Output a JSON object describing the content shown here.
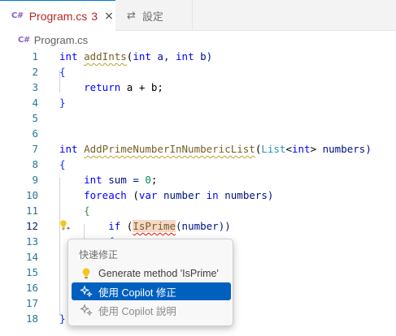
{
  "tabs": [
    {
      "icon": "C#",
      "title": "Program.cs",
      "badge": "3",
      "close": "×"
    },
    {
      "icon": "⇄",
      "title": "設定"
    }
  ],
  "breadcrumb": {
    "icon": "C#",
    "file": "Program.cs"
  },
  "line_numbers": [
    "1",
    "2",
    "3",
    "4",
    "5",
    "6",
    "7",
    "8",
    "9",
    "10",
    "11",
    "12",
    "13",
    "14",
    "15",
    "16",
    "17",
    "18"
  ],
  "code": {
    "l1": {
      "int": "int",
      "fn": "addInts",
      "p1": "(",
      "int2": "int",
      "a": " a, ",
      "int3": "int",
      "b": " b)"
    },
    "l2": "{",
    "l3": {
      "ret": "return",
      "expr": " a + b;"
    },
    "l4": "}",
    "l7": {
      "int": "int",
      "fn": "AddPrimeNumberInNumbericList",
      "p1": "(",
      "list": "List",
      "lt": "<",
      "int2": "int",
      "gt": ">",
      "numbers": " numbers)"
    },
    "l8": "{",
    "l9": {
      "int": "int",
      "rest": " sum = ",
      "zero": "0",
      "semi": ";"
    },
    "l10": {
      "foreach": "foreach",
      "p1": " (",
      "var": "var",
      "number": " number ",
      "in": "in",
      "numbers": " numbers)"
    },
    "l11": "{",
    "l12": {
      "if": "if",
      "p1": " (",
      "fn": "IsPrime",
      "arg": "(number))"
    },
    "l13": "{",
    "l18": "}"
  },
  "quick_fix": {
    "header": "快速修正",
    "items": [
      {
        "label": "Generate method 'IsPrime'",
        "icon": "lightbulb-icon"
      },
      {
        "label": "使用 Copilot 修正",
        "icon": "sparkle-icon",
        "selected": true
      },
      {
        "label": "使用 Copilot 說明",
        "icon": "sparkle-icon"
      }
    ]
  },
  "colors": {
    "accent": "#0060c0",
    "error": "#e51400",
    "bulb": "#f5c518"
  }
}
